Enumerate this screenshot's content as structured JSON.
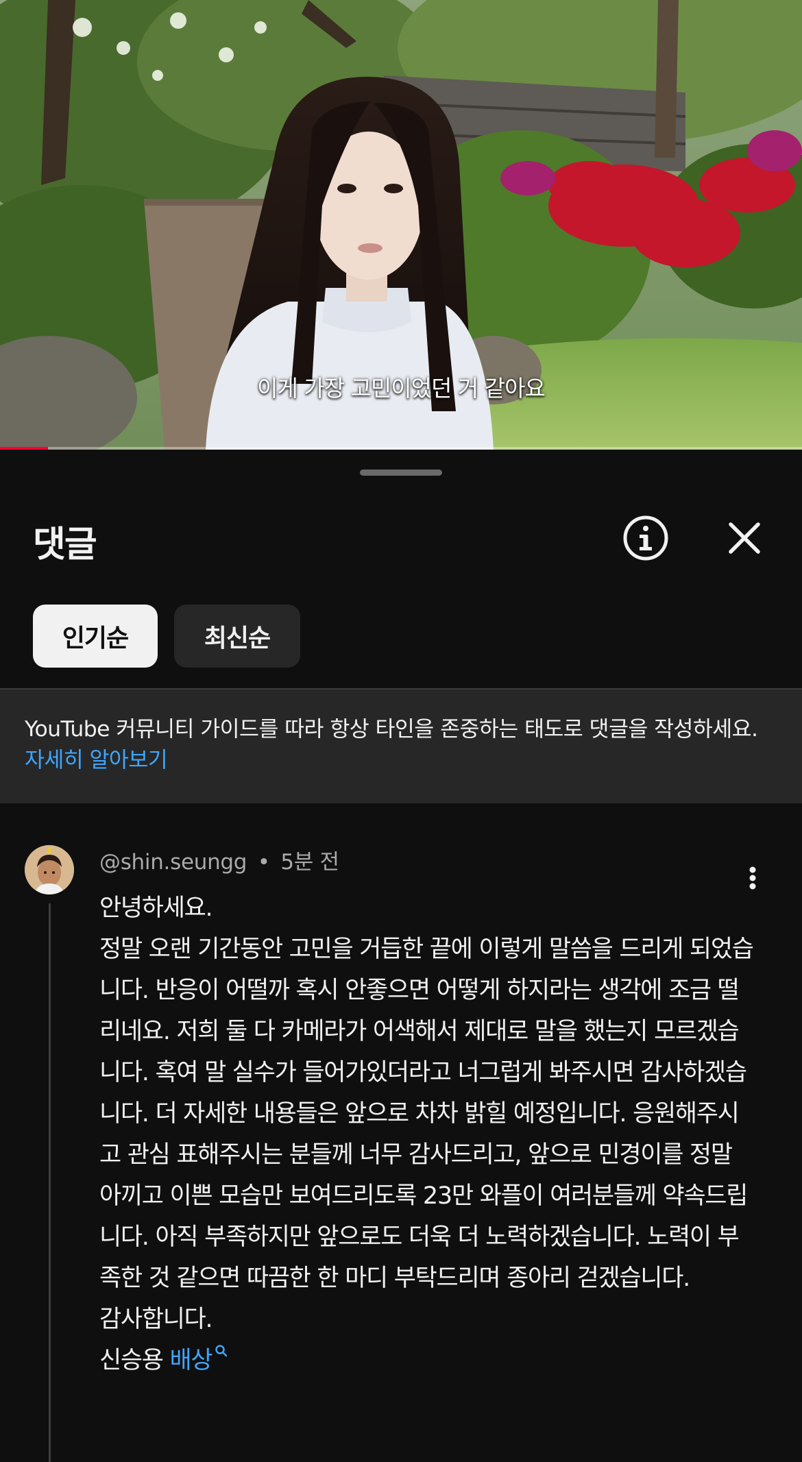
{
  "video": {
    "subtitle": "이게 가장 고민이었던 거 같아요",
    "progress_fraction": 0.06,
    "progress_color": "#ff0033"
  },
  "sheet": {
    "title": "댓글",
    "info_icon": "info-circle-icon",
    "close_icon": "close-icon"
  },
  "sort_chips": [
    {
      "label": "인기순",
      "selected": true
    },
    {
      "label": "최신순",
      "selected": false
    }
  ],
  "guideline": {
    "text": "YouTube 커뮤니티 가이드를 따라 항상 타인을 존중하는 태도로 댓글을 작성하세요.",
    "link": "자세히 알아보기",
    "link_color": "#3ea6ff"
  },
  "comment": {
    "author": "@shin.seungg",
    "separator": "•",
    "time": "5분 전",
    "lines": [
      "안녕하세요.",
      "정말 오랜 기간동안 고민을 거듭한 끝에 이렇게 말씀을 드리게 되었습니다. 반응이 어떨까 혹시 안좋으면 어떻게 하지라는 생각에 조금 떨리네요. 저희 둘 다 카메라가 어색해서 제대로 말을 했는지 모르겠습니다. 혹여 말 실수가 들어가있더라고 너그럽게 봐주시면 감사하겠습니다. 더 자세한 내용들은 앞으로 차차 밝힐 예정입니다. 응원해주시고 관심 표해주시는 분들께 너무 감사드리고, 앞으로 민경이를 정말 아끼고 이쁜 모습만 보여드리도록 23만 와플이 여러분들께 약속드립니다. 아직 부족하지만 앞으로도 더욱 더 노력하겠습니다. 노력이 부족한 것 같으면 따끔한 한 마디 부탁드리며 종아리 걷겠습니다.",
      "감사합니다."
    ],
    "signature_name": "신승용",
    "signature_tag": "배상",
    "tag_icon": "search-icon",
    "more_icon": "more-vertical-icon"
  }
}
